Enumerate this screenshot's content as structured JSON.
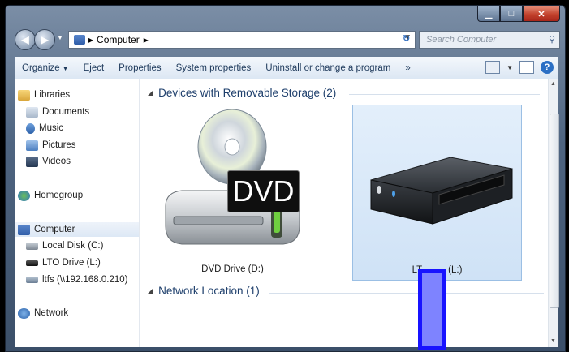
{
  "address": {
    "segment": "Computer",
    "sep1": "▸",
    "sep2": "▸"
  },
  "search": {
    "placeholder": "Search Computer"
  },
  "toolbar": {
    "items": [
      "Organize",
      "Eject",
      "Properties",
      "System properties",
      "Uninstall or change a program",
      "»"
    ],
    "organize_arrow": "▼"
  },
  "nav": {
    "libraries": "Libraries",
    "documents": "Documents",
    "music": "Music",
    "pictures": "Pictures",
    "videos": "Videos",
    "homegroup": "Homegroup",
    "computer": "Computer",
    "local_disk": "Local Disk (C:)",
    "lto_drive": "LTO Drive (L:)",
    "itfs": "ltfs (\\\\192.168.0.210)",
    "network": "Network"
  },
  "groups": {
    "removable": "Devices with Removable Storage (2)",
    "network": "Network Location (1)"
  },
  "tiles": {
    "dvd_label": "DVD Drive (D:)",
    "dvd_badge": "DVD",
    "lto_label_left": "LT",
    "lto_label_right": "(L:)"
  },
  "colors": {
    "accent": "#1e3f6c",
    "overlay": "#7e83ff",
    "overlay_border": "#1813ff"
  }
}
